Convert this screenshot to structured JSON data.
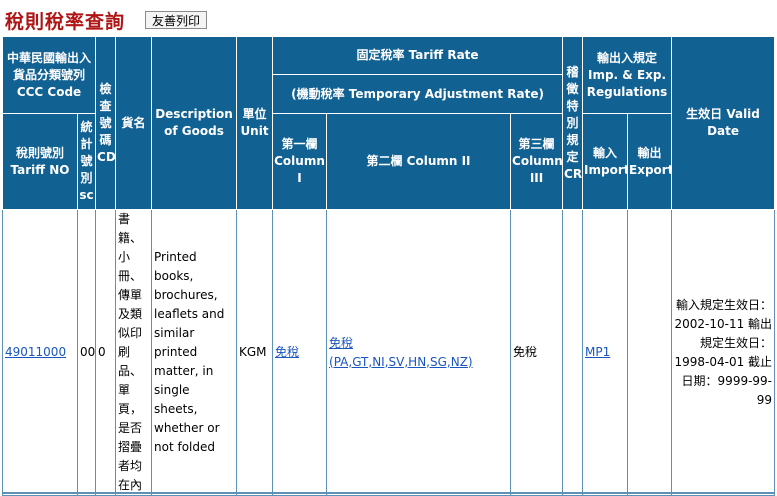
{
  "header": {
    "title": "稅則稅率查詢",
    "print_button": "友善列印"
  },
  "columns": {
    "ccc_code": "中華民國輸出入貨品分類號列CCC Code",
    "inspect_code": "檢查號碼CD",
    "goods_name": "貨名",
    "description": "Description of Goods",
    "unit": "單位 Unit",
    "tariff_rate": "固定稅率 Tariff Rate",
    "temp_adjust": "(機動稅率 Temporary Adjustment Rate)",
    "special": "稽徵特別規定CR",
    "regulations": "輸出入規定 Imp. & Exp. Regulations",
    "valid_date": "生效日 Valid Date",
    "tariff_no": "稅則號別 Tariff NO",
    "stat_code": "統計號別sc",
    "col1": "第一欄 Column I",
    "col2": "第二欄 Column II",
    "col3": "第三欄 Column III",
    "import": "輸入 Import",
    "export": "輸出 Export"
  },
  "row": {
    "tariff_no": "49011000",
    "stat_code": "00",
    "check_digit": "0",
    "goods_name": "書籍、小冊、傳單及類似印刷品、單頁，是否摺疊者均在內",
    "description": "Printed books, brochures, leaflets and similar printed matter, in single sheets, whether or not folded",
    "unit": "KGM",
    "col1": "免稅",
    "col2_main": "免稅",
    "col2_countries": "(PA,GT,NI,SV,HN,SG,NZ)",
    "col3": "免稅",
    "special": "",
    "import": "MP1",
    "export": "",
    "valid_date": "輸入規定生效日：2002-10-11 輸出規定生效日：1998-04-01 截止日期：9999-99-99"
  }
}
